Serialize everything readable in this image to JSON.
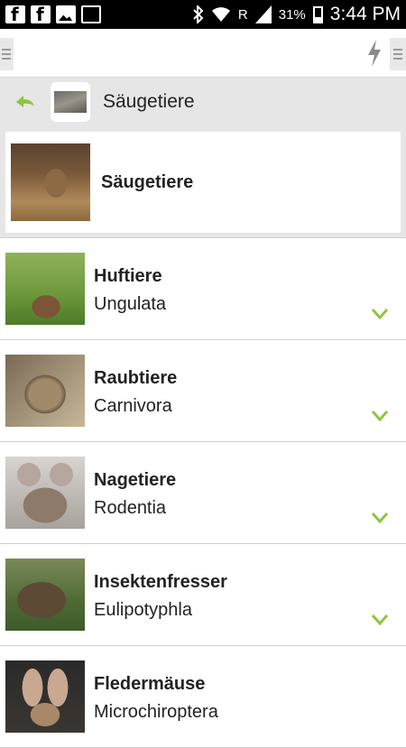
{
  "status_bar": {
    "signal_label": "R",
    "battery": "31%",
    "time": "3:44 PM",
    "icons": [
      "facebook-icon",
      "facebook-icon",
      "gallery-icon",
      "voicemail-icon",
      "bluetooth-icon",
      "wifi-icon",
      "signal-icon",
      "battery-icon"
    ]
  },
  "app_bar": {
    "icons": [
      "menu-icon",
      "lightning-icon",
      "menu-icon"
    ],
    "accent_color": "#8dc63f"
  },
  "breadcrumb": {
    "title": "Säugetiere"
  },
  "header_card": {
    "title": "Säugetiere"
  },
  "list": {
    "items": [
      {
        "title": "Huftiere",
        "subtitle": "Ungulata"
      },
      {
        "title": "Raubtiere",
        "subtitle": "Carnivora"
      },
      {
        "title": "Nagetiere",
        "subtitle": "Rodentia"
      },
      {
        "title": "Insektenfresser",
        "subtitle": "Eulipotyphla"
      },
      {
        "title": "Fledermäuse",
        "subtitle": "Microchiroptera"
      }
    ]
  }
}
